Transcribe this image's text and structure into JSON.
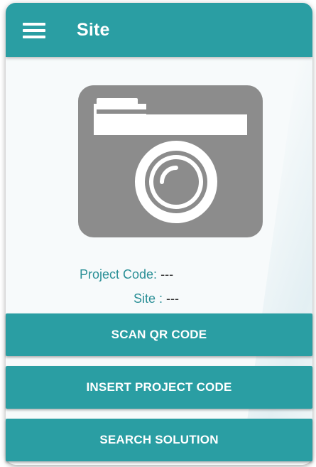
{
  "app_bar": {
    "title": "Site",
    "menu_icon": "hamburger-menu-icon"
  },
  "photo_placeholder": {
    "icon": "camera-icon",
    "color": "#8c8c8c"
  },
  "info": {
    "project_code_label": "Project Code:",
    "project_code_value": "---",
    "site_label": "Site :",
    "site_value": "---"
  },
  "buttons": {
    "scan_qr": "SCAN QR CODE",
    "insert_project_code": "INSERT PROJECT CODE",
    "search_solution": "SEARCH SOLUTION"
  },
  "colors": {
    "primary": "#2a9ea3",
    "label_text": "#2a8f96",
    "background": "#f7fafb"
  }
}
